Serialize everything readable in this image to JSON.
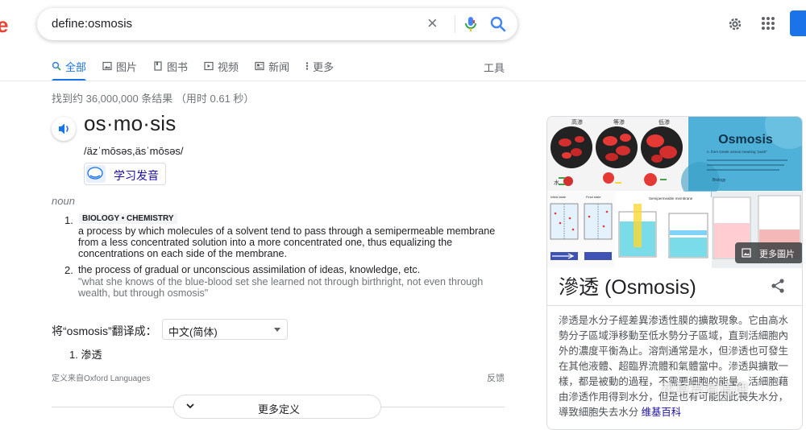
{
  "header": {
    "logo_fragment": "e",
    "search_value": "define:osmosis"
  },
  "tabs": [
    {
      "label": "全部",
      "icon": "search-icon",
      "active": true
    },
    {
      "label": "图片",
      "icon": "image-icon",
      "active": false
    },
    {
      "label": "图书",
      "icon": "book-icon",
      "active": false
    },
    {
      "label": "视频",
      "icon": "play-icon",
      "active": false
    },
    {
      "label": "新闻",
      "icon": "news-icon",
      "active": false
    },
    {
      "label": "更多",
      "icon": "more-vert-icon",
      "active": false
    }
  ],
  "tools_label": "工具",
  "stats": "找到约 36,000,000 条结果 （用时 0.61 秒）",
  "dictionary": {
    "word": "os·mo·sis",
    "phonetic": "/äzˈmōsəs,äsˈmōsəs/",
    "learn_label": "学习发音",
    "part_of_speech": "noun",
    "definitions": [
      {
        "num": "1.",
        "tag": "BIOLOGY • CHEMISTRY",
        "text": "a process by which molecules of a solvent tend to pass through a semipermeable membrane from a less concentrated solution into a more concentrated one, thus equalizing the concentrations on each side of the membrane."
      },
      {
        "num": "2.",
        "text": "the process of gradual or unconscious assimilation of ideas, knowledge, etc.",
        "example": "\"what she knows of the blue-blood set she learned not through birthright, not even through wealth, but through osmosis\""
      }
    ],
    "translate_label": "将“osmosis”翻译成：",
    "translate_lang": "中文(简体)",
    "translation": "1. 渗透",
    "source": "定义来自Oxford Languages",
    "feedback": "反馈",
    "more_label": "更多定义"
  },
  "knowledge_panel": {
    "images": {
      "osmosis_card_title": "Osmosis",
      "osmosis_card_sub": "n. from Greek osmos meaning \"push\"",
      "osmosis_card_text": "In biology, the net movement of water molecules through the cell membrane from an area of higher to an area of lower water potential",
      "osmosis_card_brand": "Biology",
      "cell_labels": [
        "高渗",
        "等渗",
        "低渗"
      ],
      "cell_water": "水",
      "beaker_labels": [
        "Initial state",
        "Final state"
      ],
      "membrane_label": "Semipermeable membrane",
      "more_images": "更多圖片"
    },
    "title": "滲透 (Osmosis)",
    "description": "滲透是水分子經差異渗透性膜的擴散現象。它由高水勢分子區域淨移動至低水勢分子區域，直到活細胞內外的濃度平衡為止。溶劑通常是水，但滲透也可發生在其他液體、超臨界流體和氣體當中。滲透與擴散一樣，都是被動的過程，不需要細胞的能量。活細胞藉由滲透作用得到水分，但是也有可能因此喪失水分，導致細胞失去水分",
    "link": "维基百科"
  },
  "watermark": "花草君有道理",
  "colors": {
    "accent": "#1a73e8",
    "link": "#1a0dab",
    "logo_red": "#ea4335"
  }
}
